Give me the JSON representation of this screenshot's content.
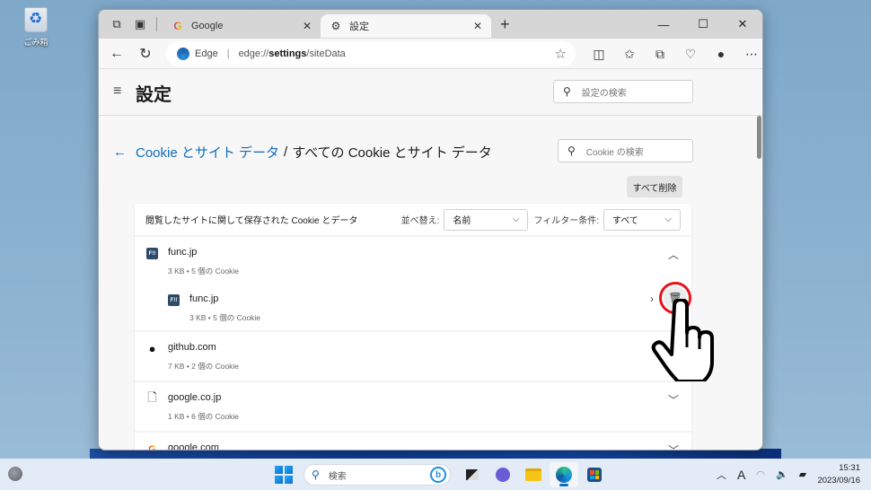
{
  "desktop": {
    "icons": [
      {
        "label": "ごみ箱",
        "icon": "recycle-bin-icon"
      }
    ]
  },
  "browser": {
    "tabs": [
      {
        "label": "Google",
        "icon": "google-favicon",
        "active": false
      },
      {
        "label": "設定",
        "icon": "gear-icon",
        "active": true
      }
    ],
    "new_tab_symbol": "+",
    "window_controls": {
      "minimize": "—",
      "maximize": "☐",
      "close": "✕"
    },
    "address_bar": {
      "site_label": "Edge",
      "url_prefix": "edge://",
      "url_bold": "settings",
      "url_suffix": "/siteData"
    }
  },
  "settings": {
    "title": "設定",
    "search_placeholder": "設定の検索",
    "breadcrumb": {
      "parent": "Cookie とサイト データ",
      "separator": "/",
      "current": "すべての Cookie とサイト データ"
    },
    "cookie_search_placeholder": "Cookie の検索",
    "delete_all_label": "すべて削除",
    "card": {
      "title": "閲覧したサイトに関して保存された Cookie とデータ",
      "sort_label": "並べ替え:",
      "sort_value": "名前",
      "filter_label": "フィルター条件:",
      "filter_value": "すべて"
    },
    "sites": [
      {
        "name": "func.jp",
        "meta": "3 KB • 5 個の Cookie",
        "icon": "func-favicon",
        "expanded": true,
        "children": [
          {
            "name": "func.jp",
            "meta": "3 KB • 5 個の Cookie",
            "icon": "func-favicon"
          }
        ]
      },
      {
        "name": "github.com",
        "meta": "7 KB • 2 個の Cookie",
        "icon": "github-icon",
        "expanded": false
      },
      {
        "name": "google.co.jp",
        "meta": "1 KB • 6 個の Cookie",
        "icon": "document-icon",
        "expanded": false
      },
      {
        "name": "google.com",
        "meta": "",
        "icon": "google-favicon",
        "expanded": false
      }
    ]
  },
  "annotation": {
    "highlight_color": "#e3141b",
    "target": "delete-site-data-button"
  },
  "taskbar": {
    "search_placeholder": "検索",
    "ime_indicator": "A",
    "time": "15:31",
    "date": "2023/09/16"
  }
}
